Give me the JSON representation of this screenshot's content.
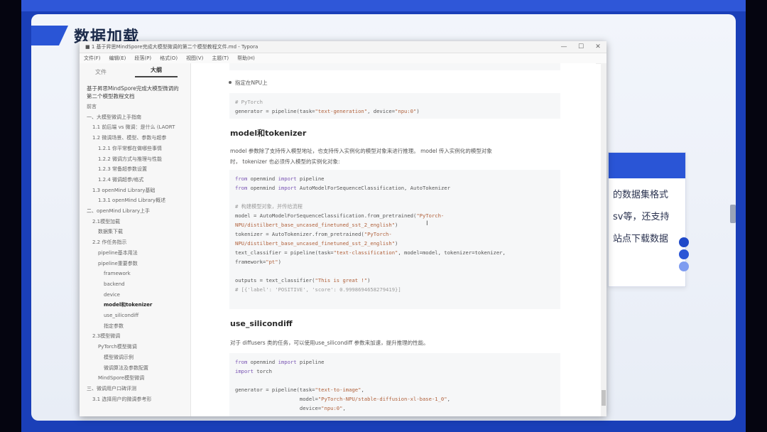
{
  "slide": {
    "title": "数据加载",
    "side_card_lines": [
      "的数据集格式",
      "sv等，还支持",
      "站点下载数据"
    ]
  },
  "window": {
    "title": "■ 1 基于昇思MindSpore完成大模型微调的第二个模型教程文件.md - Typora",
    "menu": [
      "文件(F)",
      "编辑(E)",
      "段落(P)",
      "格式(O)",
      "视图(V)",
      "主题(T)",
      "帮助(H)"
    ],
    "controls": [
      "—",
      "☐",
      "✕"
    ]
  },
  "sidebar": {
    "tabs": [
      "文件",
      "大纲"
    ],
    "doc_title": "基于昇思MindSpore完成大模型微调的第二个模型教程文档",
    "outline": [
      {
        "text": "前言",
        "level": 0
      },
      {
        "text": "一、大模型微调上手指南",
        "level": 0
      },
      {
        "text": "1.1 前后端 vs 微调：是什么 (LAORT",
        "level": 1
      },
      {
        "text": "1.2 微调场景、模型、参数与超参",
        "level": 1
      },
      {
        "text": "1.2.1 你平常都在做哪些事情",
        "level": 2
      },
      {
        "text": "1.2.2 微调方式与推理与性能",
        "level": 2
      },
      {
        "text": "1.2.3 常备超参数设置",
        "level": 2
      },
      {
        "text": "1.2.4 微调超参/格式",
        "level": 2
      },
      {
        "text": "1.3 openMind Library基础",
        "level": 1
      },
      {
        "text": "1.3.1 openMind Library概述",
        "level": 2
      },
      {
        "text": "二、openMind Library上手",
        "level": 0
      },
      {
        "text": "2.1模型加载",
        "level": 1
      },
      {
        "text": "数据集下载",
        "level": 2
      },
      {
        "text": "2.2 作任务指示",
        "level": 1
      },
      {
        "text": "pipeline基本用法",
        "level": 2
      },
      {
        "text": "pipeline重要参数",
        "level": 2
      },
      {
        "text": "framework",
        "level": 3
      },
      {
        "text": "backend",
        "level": 3
      },
      {
        "text": "device",
        "level": 3
      },
      {
        "text": "model和tokenizer",
        "level": 3,
        "active": true
      },
      {
        "text": "use_silicondiff",
        "level": 3
      },
      {
        "text": "指定参数",
        "level": 3
      },
      {
        "text": "2.3模型微调",
        "level": 1
      },
      {
        "text": "PyTorch模型微调",
        "level": 2
      },
      {
        "text": "模型微调示例",
        "level": 3
      },
      {
        "text": "微调算法及参数配置",
        "level": 3
      },
      {
        "text": "MindSpore模型微调",
        "level": 2
      },
      {
        "text": "三、微调用户口碑评测",
        "level": 0
      },
      {
        "text": "3.1 选择用户的微调参考形",
        "level": 1
      }
    ]
  },
  "content": {
    "bullet_npu": "指定在NPU上",
    "code1": {
      "comment": "# PyTorch",
      "line_pre": "generator = pipeline(task=",
      "task": "\"text-generation\"",
      "mid": ", device=",
      "device": "\"npu:0\"",
      "end": ")"
    },
    "h_model": "model和tokenizer",
    "para_model_1": "model 参数除了支持传入模型地址，也支持传入实例化的模型对象来进行推理。 model 传入实例化的模型对象",
    "para_model_2": "时， tokenizer 也必须传入模型的实例化对象:",
    "code2": {
      "l1_kw1": "from",
      "l1_mod": " openmind ",
      "l1_kw2": "import",
      "l1_rest": " pipeline",
      "l2_kw1": "from",
      "l2_mod": " openmind ",
      "l2_kw2": "import",
      "l2_rest": " AutoModelForSequenceClassification, AutoTokenizer",
      "comment": "# 构建模型对象，并传给流程",
      "l4": "model = AutoModelForSequenceClassification.from_pretrained(",
      "l4s": "\"PyTorch-",
      "l5s": "NPU/distilbert_base_uncased_finetuned_sst_2_english\"",
      "l5e": ")",
      "l6": "tokenizer = AutoTokenizer.from_pretrained(",
      "l6s": "\"PyTorch-",
      "l7s": "NPU/distilbert_base_uncased_finetuned_sst_2_english\"",
      "l7e": ")",
      "l8": "text_classifier = pipeline(task=",
      "l8s": "\"text-classification\"",
      "l8e": ", model=model, tokenizer=tokenizer,",
      "l9": "framework=",
      "l9s": "\"pt\"",
      "l9e": ")",
      "l10": "outputs = text_classifier(",
      "l10s": "\"This is great !\"",
      "l10e": ")",
      "l11": "# [{'label': 'POSITIVE', 'score': 0.9998694658279419}]"
    },
    "h_silicon": "use_silicondiff",
    "para_silicon": "对于 diffusers 类的任务，可以使用use_silicondiff 参数来加速，提升推理的性能。",
    "code3": {
      "l1_kw1": "from",
      "l1_mod": " openmind ",
      "l1_kw2": "import",
      "l1_rest": " pipeline",
      "l2_kw": "import",
      "l2_rest": " torch",
      "l3": "generator = pipeline(task=",
      "l3s": "\"text-to-image\"",
      "l3e": ",",
      "l4": "                     model=",
      "l4s": "\"PyTorch-NPU/stable-diffusion-xl-base-1_0\"",
      "l4e": ",",
      "l5": "                     device=",
      "l5s": "\"npu:0\"",
      "l5e": ","
    }
  }
}
